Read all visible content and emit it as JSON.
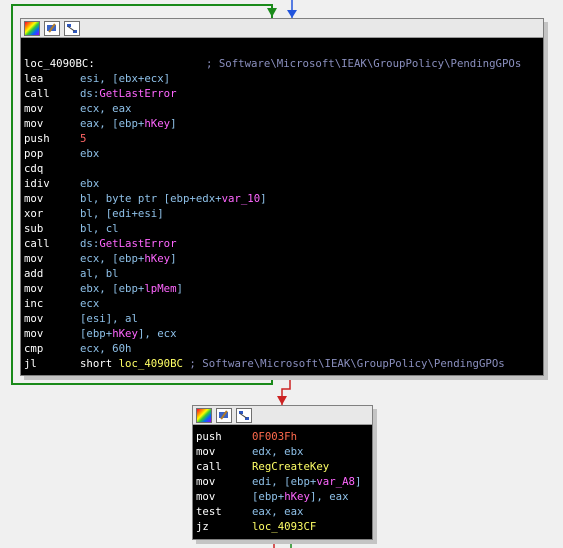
{
  "colors": {
    "background": "#f0f0f0",
    "block_bg": "#000000",
    "loop_arrow": "#1a8a1a",
    "true_arrow": "#1a8a1a",
    "false_arrow": "#cc2222",
    "incoming_arrow": "#2255dd"
  },
  "toolbar_icons": [
    "color-palette-icon",
    "rename-icon",
    "graph-icon"
  ],
  "loop_block": {
    "label": "loc_4090BC:",
    "label_comment": "; Software\\Microsoft\\IEAK\\GroupPolicy\\PendingGPOs",
    "instructions": [
      {
        "mnemonic": "lea",
        "parts": [
          {
            "t": "esi, [ebx+ecx]",
            "c": "reg"
          }
        ]
      },
      {
        "mnemonic": "call",
        "parts": [
          {
            "t": "ds:",
            "c": "reg"
          },
          {
            "t": "GetLastError",
            "c": "api"
          }
        ]
      },
      {
        "mnemonic": "mov",
        "parts": [
          {
            "t": "ecx, eax",
            "c": "reg"
          }
        ]
      },
      {
        "mnemonic": "mov",
        "parts": [
          {
            "t": "eax, [ebp+",
            "c": "reg"
          },
          {
            "t": "hKey",
            "c": "var"
          },
          {
            "t": "]",
            "c": "reg"
          }
        ]
      },
      {
        "mnemonic": "push",
        "parts": [
          {
            "t": "5",
            "c": "num"
          }
        ]
      },
      {
        "mnemonic": "pop",
        "parts": [
          {
            "t": "ebx",
            "c": "reg"
          }
        ]
      },
      {
        "mnemonic": "cdq",
        "parts": []
      },
      {
        "mnemonic": "idiv",
        "parts": [
          {
            "t": "ebx",
            "c": "reg"
          }
        ]
      },
      {
        "mnemonic": "mov",
        "parts": [
          {
            "t": "bl, byte ptr [ebp+edx+",
            "c": "reg"
          },
          {
            "t": "var_10",
            "c": "var"
          },
          {
            "t": "]",
            "c": "reg"
          }
        ]
      },
      {
        "mnemonic": "xor",
        "parts": [
          {
            "t": "bl, [edi+esi]",
            "c": "reg"
          }
        ]
      },
      {
        "mnemonic": "sub",
        "parts": [
          {
            "t": "bl, cl",
            "c": "reg"
          }
        ]
      },
      {
        "mnemonic": "call",
        "parts": [
          {
            "t": "ds:",
            "c": "reg"
          },
          {
            "t": "GetLastError",
            "c": "api"
          }
        ]
      },
      {
        "mnemonic": "mov",
        "parts": [
          {
            "t": "ecx, [ebp+",
            "c": "reg"
          },
          {
            "t": "hKey",
            "c": "var"
          },
          {
            "t": "]",
            "c": "reg"
          }
        ]
      },
      {
        "mnemonic": "add",
        "parts": [
          {
            "t": "al, bl",
            "c": "reg"
          }
        ]
      },
      {
        "mnemonic": "mov",
        "parts": [
          {
            "t": "ebx, [ebp+",
            "c": "reg"
          },
          {
            "t": "lpMem",
            "c": "var"
          },
          {
            "t": "]",
            "c": "reg"
          }
        ]
      },
      {
        "mnemonic": "inc",
        "parts": [
          {
            "t": "ecx",
            "c": "reg"
          }
        ]
      },
      {
        "mnemonic": "mov",
        "parts": [
          {
            "t": "[esi], al",
            "c": "reg"
          }
        ]
      },
      {
        "mnemonic": "mov",
        "parts": [
          {
            "t": "[ebp+",
            "c": "reg"
          },
          {
            "t": "hKey",
            "c": "var"
          },
          {
            "t": "], ecx",
            "c": "reg"
          }
        ]
      },
      {
        "mnemonic": "cmp",
        "parts": [
          {
            "t": "ecx, 60h",
            "c": "reg"
          }
        ]
      },
      {
        "mnemonic": "jl",
        "parts": [
          {
            "t": "short ",
            "c": "plain"
          },
          {
            "t": "loc_4090BC",
            "c": "loc"
          },
          {
            "t": " ; Software\\Microsoft\\IEAK\\GroupPolicy\\PendingGPOs",
            "c": "comment"
          }
        ]
      }
    ]
  },
  "exit_block": {
    "instructions": [
      {
        "mnemonic": "push",
        "parts": [
          {
            "t": "0F003Fh",
            "c": "imm"
          }
        ]
      },
      {
        "mnemonic": "mov",
        "parts": [
          {
            "t": "edx, ebx",
            "c": "reg"
          }
        ]
      },
      {
        "mnemonic": "call",
        "parts": [
          {
            "t": "RegCreateKey",
            "c": "loc"
          }
        ]
      },
      {
        "mnemonic": "mov",
        "parts": [
          {
            "t": "edi, [ebp+",
            "c": "reg"
          },
          {
            "t": "var_A8",
            "c": "var"
          },
          {
            "t": "]",
            "c": "reg"
          }
        ]
      },
      {
        "mnemonic": "mov",
        "parts": [
          {
            "t": "[ebp+",
            "c": "reg"
          },
          {
            "t": "hKey",
            "c": "var"
          },
          {
            "t": "], eax",
            "c": "reg"
          }
        ]
      },
      {
        "mnemonic": "test",
        "parts": [
          {
            "t": "eax, eax",
            "c": "reg"
          }
        ]
      },
      {
        "mnemonic": "jz",
        "parts": [
          {
            "t": "loc_4093CF",
            "c": "loc"
          }
        ]
      }
    ]
  }
}
